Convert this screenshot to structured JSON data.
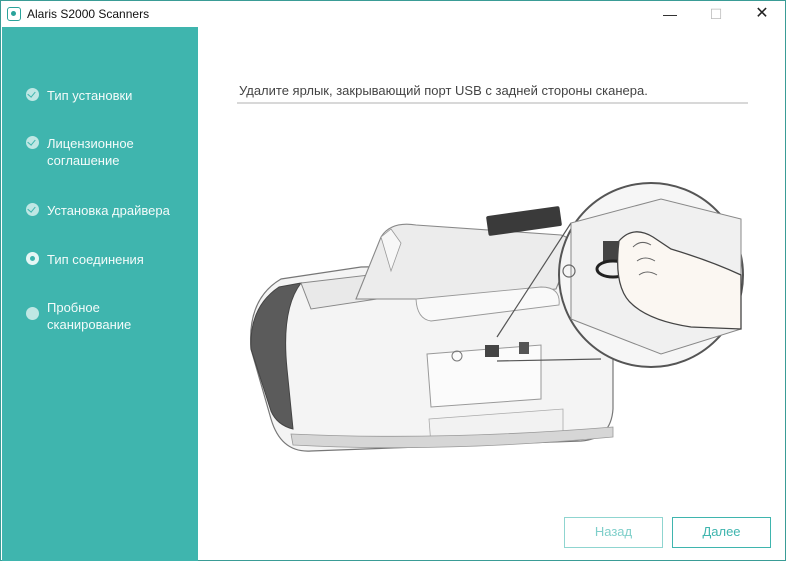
{
  "window": {
    "title": "Alaris S2000 Scanners",
    "minimize_glyph": "—",
    "maximize_glyph": "☐",
    "close_glyph": "✕"
  },
  "sidebar": {
    "steps": [
      {
        "label": "Тип установки",
        "state": "done"
      },
      {
        "label": "Лицензионное соглашение",
        "state": "done"
      },
      {
        "label": "Установка драйвера",
        "state": "done"
      },
      {
        "label": "Тип соединения",
        "state": "current"
      },
      {
        "label": "Пробное сканирование",
        "state": "pending"
      }
    ]
  },
  "main": {
    "instruction": "Удалите ярлык, закрывающий порт USB с задней стороны сканера."
  },
  "buttons": {
    "back": "Назад",
    "next": "Далее"
  },
  "colors": {
    "accent": "#3fb5ae",
    "sidebar_bg": "#3fb5ae"
  }
}
